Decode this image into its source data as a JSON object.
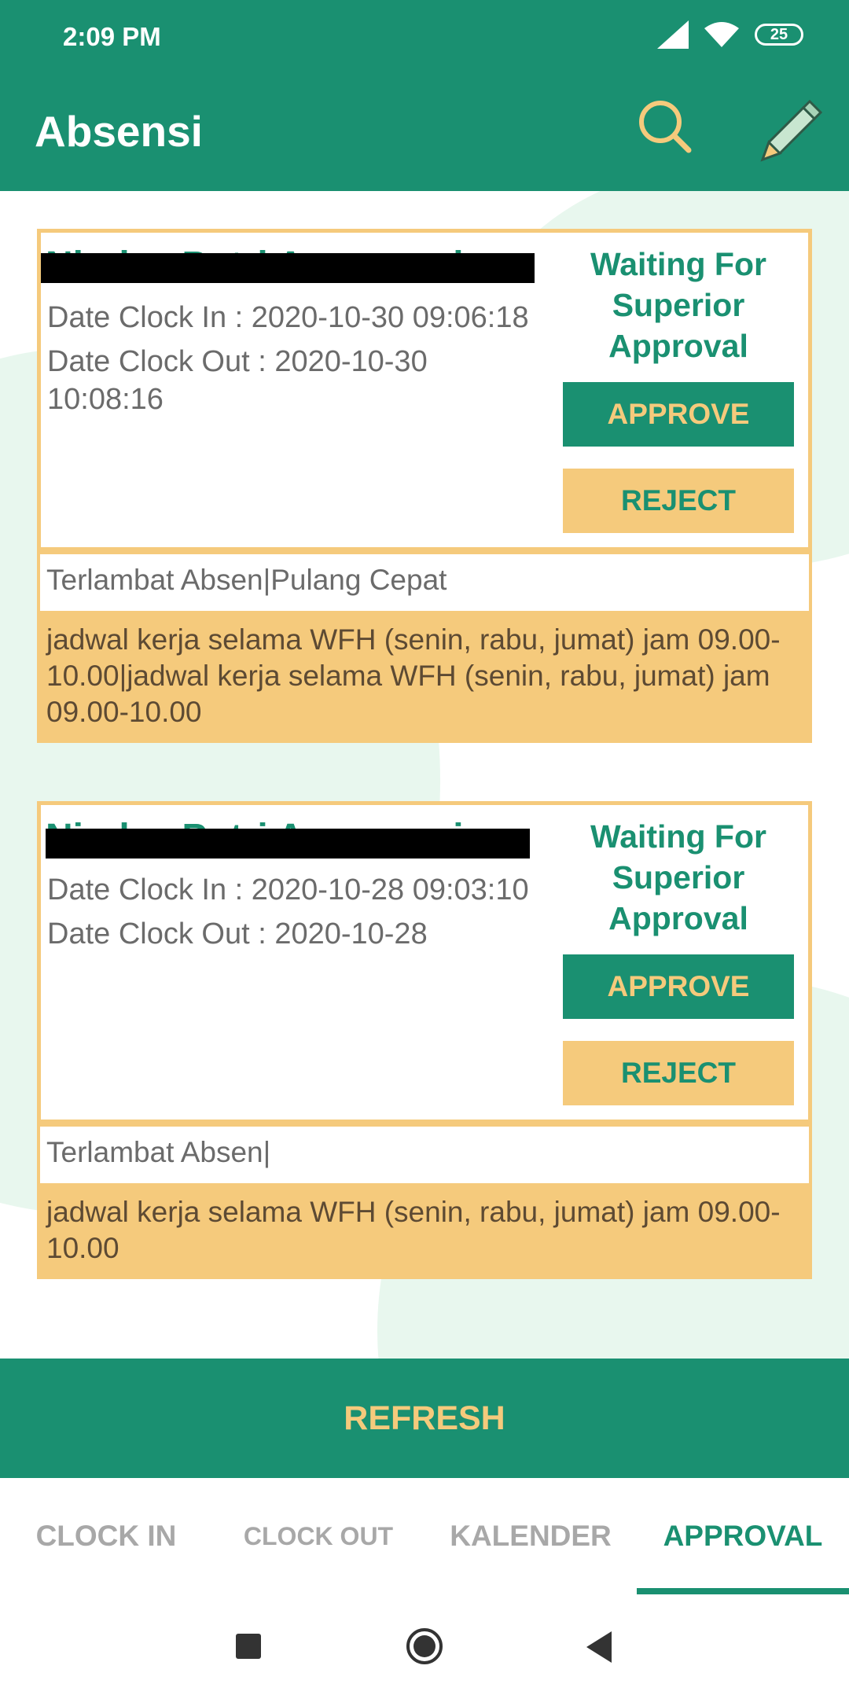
{
  "status_bar": {
    "time": "2:09 PM",
    "battery": "25"
  },
  "app_bar": {
    "title": "Absensi",
    "search_icon": "search-icon",
    "edit_icon": "pencil-icon"
  },
  "colors": {
    "primary": "#1a9071",
    "accent": "#f5ca7c",
    "text_gray": "#6b6b6b"
  },
  "cards": [
    {
      "name": "Nindya Putri Anggraeni",
      "clock_in": "Date Clock In : 2020-10-30 09:06:18",
      "clock_out": "Date Clock Out : 2020-10-30 10:08:16",
      "status": "Waiting For Superior Approval",
      "approve_label": "APPROVE",
      "reject_label": "REJECT",
      "reason_type": "Terlambat Absen|Pulang Cepat",
      "reason_detail": "jadwal kerja selama WFH (senin, rabu, jumat) jam 09.00-10.00|jadwal kerja selama WFH (senin, rabu, jumat) jam 09.00-10.00"
    },
    {
      "name": "Nindya Putri Anggraeni",
      "clock_in": "Date Clock In : 2020-10-28 09:03:10",
      "clock_out": "Date Clock Out : 2020-10-28",
      "status": "Waiting For Superior Approval",
      "approve_label": "APPROVE",
      "reject_label": "REJECT",
      "reason_type": "Terlambat Absen|",
      "reason_detail": "jadwal kerja selama WFH (senin, rabu, jumat) jam 09.00-10.00"
    }
  ],
  "refresh_label": "REFRESH",
  "tabs": [
    {
      "label": "CLOCK IN"
    },
    {
      "label": "CLOCK OUT"
    },
    {
      "label": "KALENDER"
    },
    {
      "label": "APPROVAL"
    }
  ],
  "active_tab": "APPROVAL"
}
